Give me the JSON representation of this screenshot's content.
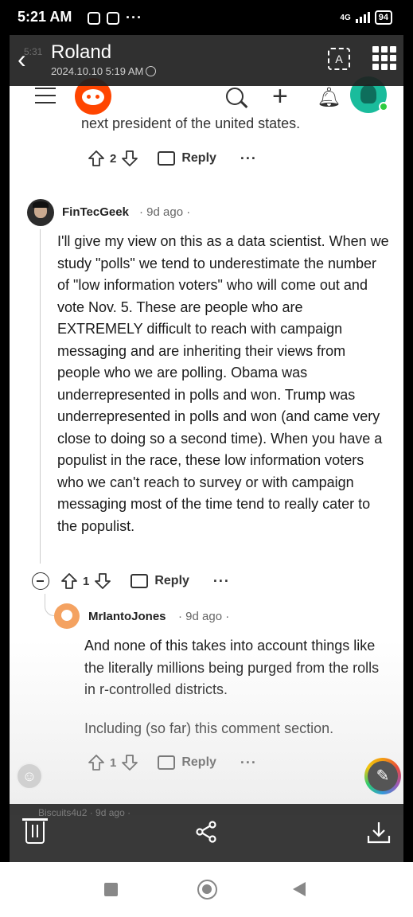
{
  "status_bar": {
    "time": "5:21 AM",
    "dots": "···",
    "network": "4G",
    "battery": "94"
  },
  "gallery": {
    "back_icon": "chevron-left-icon",
    "title": "Roland",
    "date": "2024.10.10 5:19 AM",
    "ghost_time": "5:31",
    "toolbar_icons": [
      "trash-icon",
      "share-icon",
      "download-icon"
    ]
  },
  "reddit": {
    "icons": [
      "menu-icon",
      "reddit-logo",
      "search-icon",
      "plus-icon",
      "bell-icon",
      "avatar"
    ],
    "cut_off_text": "next president of the united states.",
    "comments": [
      {
        "votes": "2",
        "reply_label": "Reply",
        "more": "···"
      },
      {
        "author": "FinTecGeek",
        "meta": "· 9d ago ·",
        "body": "I'll give my view on this as a data scientist. When we study \"polls\" we tend to underestimate the number of \"low information voters\" who will come out and vote Nov. 5. These are people who are EXTREMELY difficult to reach with campaign messaging and are inheriting their views from people who we are polling. Obama was underrepresented in polls and won. Trump was underrepresented in polls and won (and came very close to doing so a second time). When you have a populist in the race, these low information voters who we can't reach to survey or with campaign messaging most of the time tend to really cater to the populist.",
        "votes": "1",
        "reply_label": "Reply",
        "more": "···"
      },
      {
        "author": "MrIantoJones",
        "meta": "· 9d ago ·",
        "body_p1": "And none of this takes into account things like the literally millions being purged from the rolls in r-controlled districts.",
        "body_p2": "Including (so far) this comment section.",
        "votes": "1",
        "reply_label": "Reply",
        "more": "···"
      }
    ],
    "next_author_partial": "Biscuits4u2",
    "next_meta_partial": "· 9d ago ·"
  },
  "colors": {
    "reddit_orange": "#ff4500",
    "avatar_teal": "#1abc9c",
    "online_green": "#2ecc40"
  }
}
